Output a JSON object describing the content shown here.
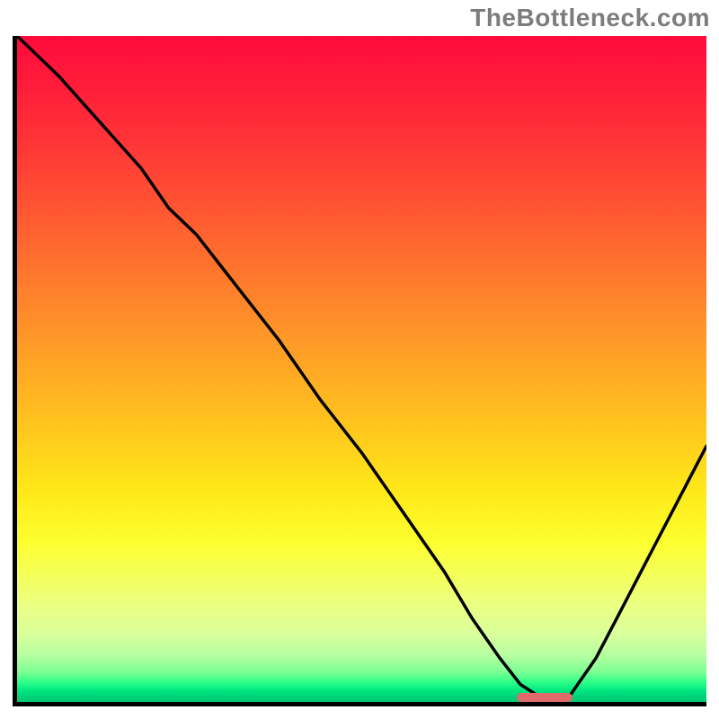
{
  "watermark": "TheBottleneck.com",
  "colors": {
    "axis": "#000000",
    "curve": "#000000",
    "marker": "#e16a6a",
    "gradient_top": "#ff0a3c",
    "gradient_bottom": "#00c873"
  },
  "chart_data": {
    "type": "line",
    "title": "",
    "xlabel": "",
    "ylabel": "",
    "xlim": [
      0,
      100
    ],
    "ylim": [
      0,
      100
    ],
    "series": [
      {
        "name": "bottleneck-curve",
        "x": [
          0,
          6,
          12,
          18,
          22,
          26,
          32,
          38,
          44,
          50,
          56,
          62,
          66,
          70,
          73,
          76,
          80,
          84,
          88,
          92,
          96,
          100
        ],
        "y": [
          100,
          94,
          87,
          80,
          74,
          70,
          62,
          54,
          45,
          37,
          28,
          19,
          12,
          6,
          2,
          0,
          0,
          6,
          14,
          22,
          30,
          38
        ]
      }
    ],
    "annotations": [
      {
        "name": "optimal-marker",
        "x_start": 72,
        "x_end": 80,
        "y": 0.7
      }
    ],
    "grid": false,
    "legend": false
  }
}
